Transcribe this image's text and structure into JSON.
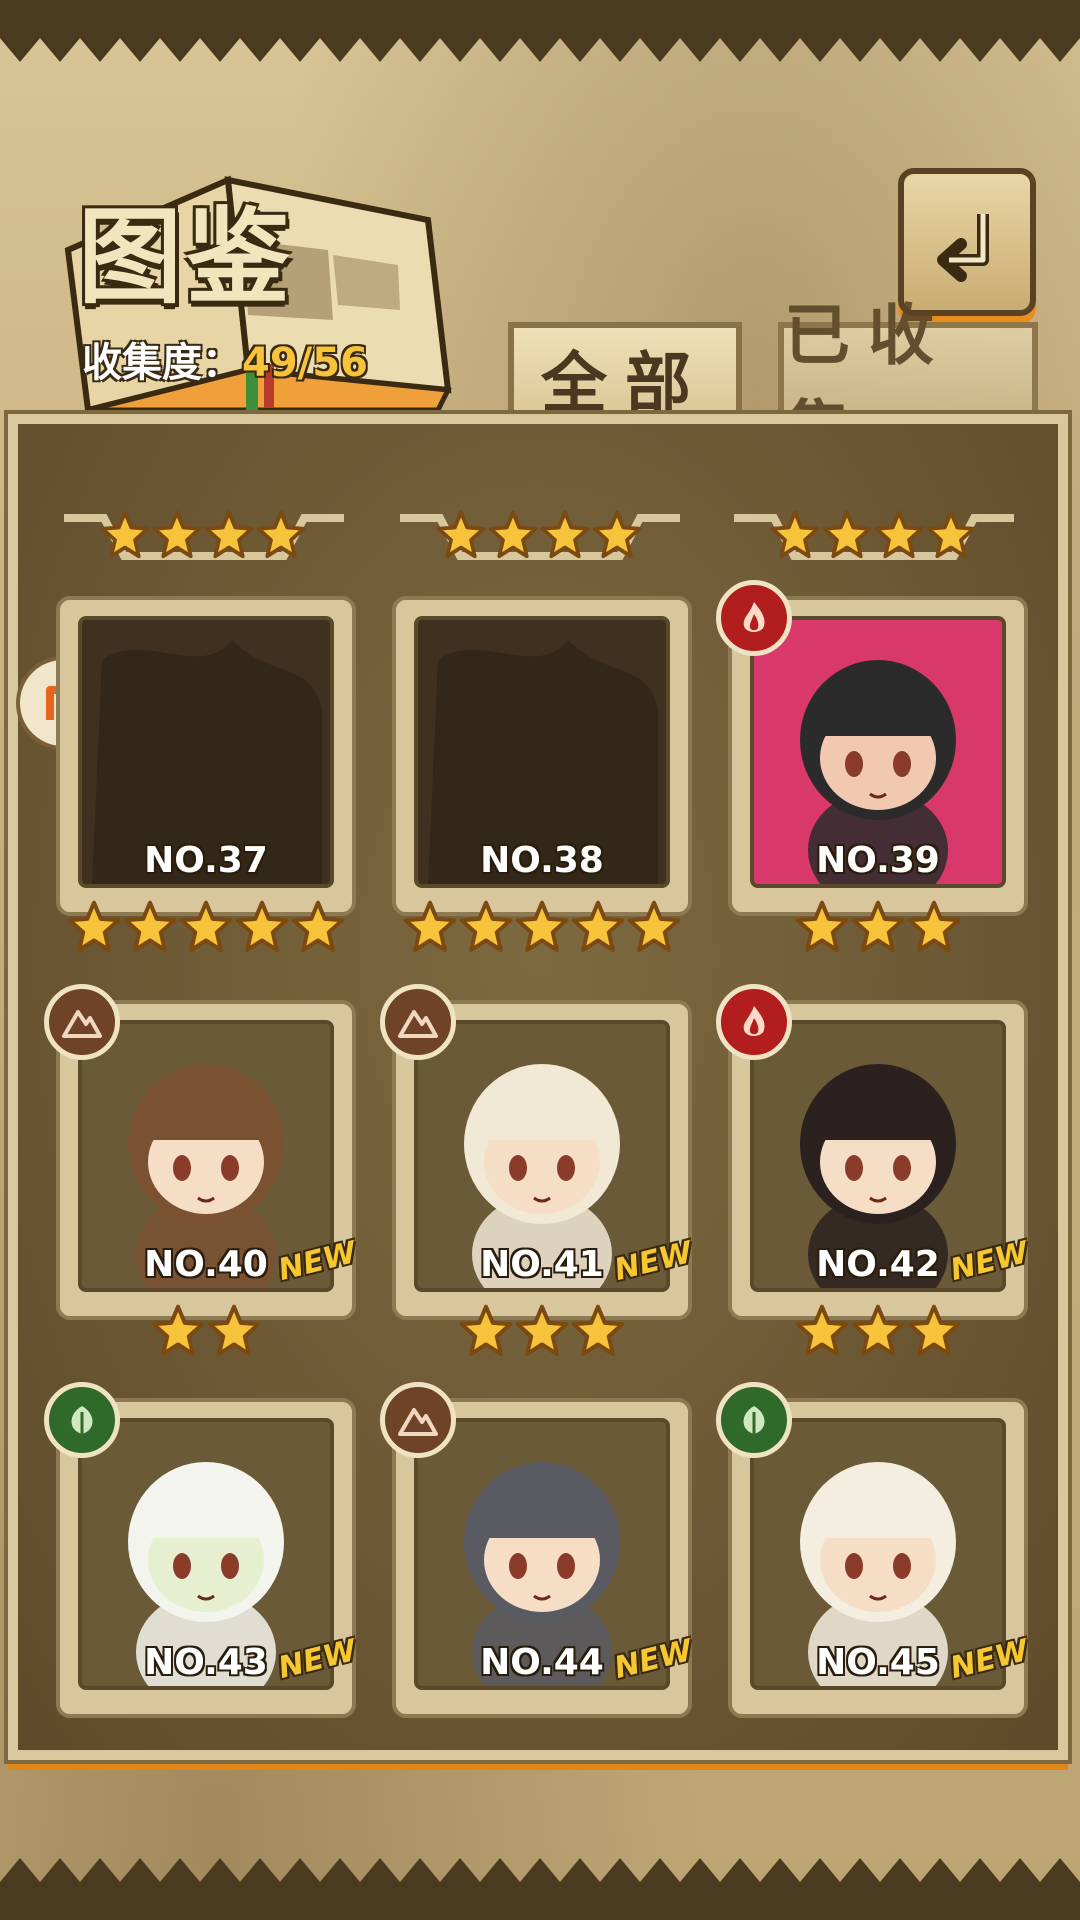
{
  "header": {
    "title": "图鉴",
    "collection_label": "收集度：",
    "collection_value": "49/56"
  },
  "back_icon": "return-arrow-icon",
  "tabs": [
    {
      "label": "全部",
      "active": true
    },
    {
      "label": "已收集",
      "active": false
    }
  ],
  "top_row_stars": [
    4,
    4,
    4
  ],
  "cards": [
    {
      "no": "NO.37",
      "stars": 5,
      "locked": true,
      "new": false,
      "element": ""
    },
    {
      "no": "NO.38",
      "stars": 5,
      "locked": true,
      "new": false,
      "element": ""
    },
    {
      "no": "NO.39",
      "stars": 3,
      "locked": false,
      "new": false,
      "element": "fire"
    },
    {
      "no": "NO.40",
      "stars": 2,
      "locked": false,
      "new": true,
      "element": "earth"
    },
    {
      "no": "NO.41",
      "stars": 3,
      "locked": false,
      "new": true,
      "element": "earth"
    },
    {
      "no": "NO.42",
      "stars": 3,
      "locked": false,
      "new": true,
      "element": "fire"
    },
    {
      "no": "NO.43",
      "stars": 0,
      "locked": false,
      "new": true,
      "element": "grass"
    },
    {
      "no": "NO.44",
      "stars": 0,
      "locked": false,
      "new": true,
      "element": "earth"
    },
    {
      "no": "NO.45",
      "stars": 0,
      "locked": false,
      "new": true,
      "element": "grass"
    }
  ],
  "new_label": "NEW",
  "colors": {
    "gold": "#f6c33a",
    "fire": "#b21d1d",
    "earth": "#6f4328",
    "grass": "#2f6a2a",
    "accent_orange": "#e0871c"
  }
}
